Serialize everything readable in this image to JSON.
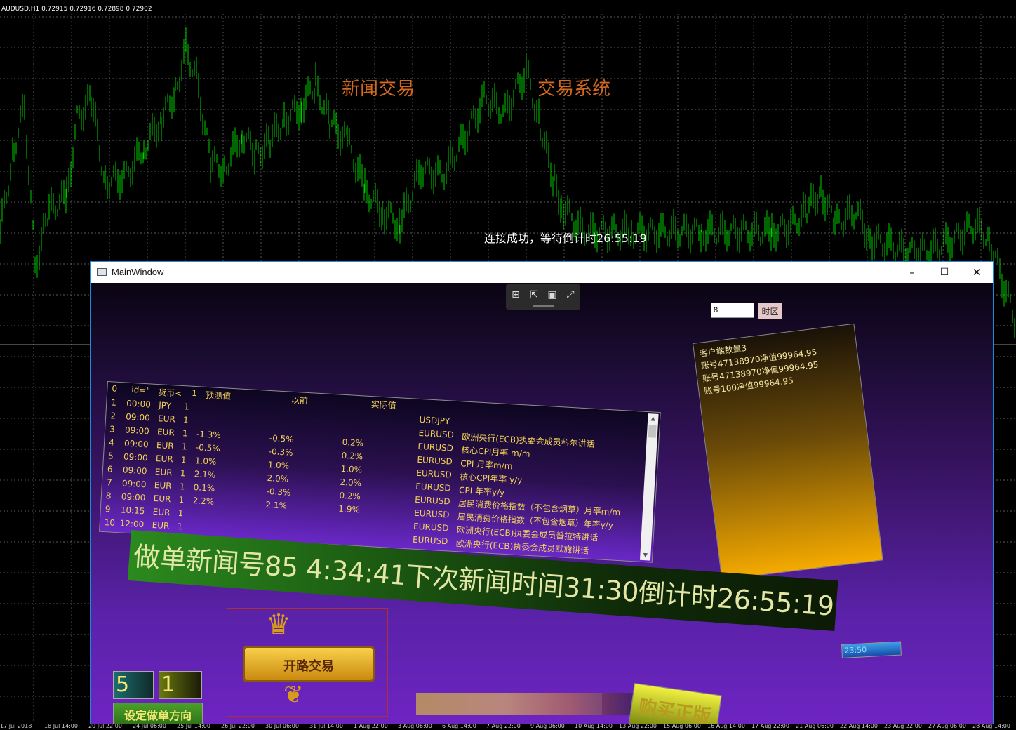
{
  "chart": {
    "title": "AUDUSD,H1  0.72915 0.72916 0.72898 0.72902",
    "caption_left": "新闻交易",
    "caption_right": "交易系统",
    "status": "连接成功，等待倒计时26:55:19",
    "x_labels": [
      "17 Jul 2018",
      "18 Jul 14:00",
      "20 Jul 22:00",
      "24 Jul 06:00",
      "25 Jul 14:00",
      "26 Jul 22:00",
      "30 Jul 06:00",
      "31 Jul 14:00",
      "1 Aug 22:00",
      "3 Aug 06:00",
      "6 Aug 14:00",
      "7 Aug 22:00",
      "9 Aug 06:00",
      "10 Aug 14:00",
      "13 Aug 22:00",
      "15 Aug 06:00",
      "16 Aug 14:00",
      "17 Aug 22:00",
      "21 Aug 06:00",
      "22 Aug 14:00",
      "23 Aug 22:00",
      "27 Aug 06:00",
      "28 Aug 14:00"
    ],
    "colors": {
      "candles": "#00cc00",
      "grid": "#7a7a7a",
      "caption": "#d2691e"
    }
  },
  "window": {
    "title": "MainWindow",
    "controls": {
      "minimize": "–",
      "maximize": "☐",
      "close": "✕"
    },
    "toolbar_icons": [
      "live-tree-icon",
      "select-element-icon",
      "display-layout-icon",
      "track-focus-icon"
    ],
    "timezone": {
      "value": "8",
      "button": "时区"
    },
    "table": {
      "header": [
        "0",
        "id=\"",
        "货币<",
        "1",
        "预测值",
        "以前",
        "实际值"
      ],
      "rows": [
        {
          "n": "1",
          "time": "00:00",
          "cur": "JPY",
          "imp": "1",
          "forecast": "",
          "previous": "",
          "actual": "",
          "symbol": "USDJPY",
          "event": ""
        },
        {
          "n": "2",
          "time": "09:00",
          "cur": "EUR",
          "imp": "1",
          "forecast": "",
          "previous": "",
          "actual": "",
          "symbol": "EURUSD",
          "event": "欧洲央行(ECB)执委会成员科尔讲话"
        },
        {
          "n": "3",
          "time": "09:00",
          "cur": "EUR",
          "imp": "1",
          "forecast": "-1.3%",
          "previous": "-0.5%",
          "actual": "0.2%",
          "symbol": "EURUSD",
          "event": "核心CPI月率 m/m"
        },
        {
          "n": "4",
          "time": "09:00",
          "cur": "EUR",
          "imp": "1",
          "forecast": "-0.5%",
          "previous": "-0.3%",
          "actual": "0.2%",
          "symbol": "EURUSD",
          "event": "CPI 月率m/m"
        },
        {
          "n": "5",
          "time": "09:00",
          "cur": "EUR",
          "imp": "1",
          "forecast": "1.0%",
          "previous": "1.0%",
          "actual": "1.0%",
          "symbol": "EURUSD",
          "event": "核心CPI年率 y/y"
        },
        {
          "n": "6",
          "time": "09:00",
          "cur": "EUR",
          "imp": "1",
          "forecast": "2.1%",
          "previous": "2.0%",
          "actual": "2.0%",
          "symbol": "EURUSD",
          "event": "CPI 年率y/y"
        },
        {
          "n": "7",
          "time": "09:00",
          "cur": "EUR",
          "imp": "1",
          "forecast": "0.1%",
          "previous": "-0.3%",
          "actual": "0.2%",
          "symbol": "EURUSD",
          "event": "居民消费价格指数（不包含烟草）月率m/m"
        },
        {
          "n": "8",
          "time": "09:00",
          "cur": "EUR",
          "imp": "1",
          "forecast": "2.2%",
          "previous": "2.1%",
          "actual": "1.9%",
          "symbol": "EURUSD",
          "event": "居民消费价格指数（不包含烟草）年率y/y"
        },
        {
          "n": "9",
          "time": "10:15",
          "cur": "EUR",
          "imp": "1",
          "forecast": "",
          "previous": "",
          "actual": "",
          "symbol": "EURUSD",
          "event": "欧洲央行(ECB)执委会成员普拉特讲话"
        },
        {
          "n": "10",
          "time": "12:00",
          "cur": "EUR",
          "imp": "1",
          "forecast": "",
          "previous": "",
          "actual": "",
          "symbol": "EURUSD",
          "event": "欧洲央行(ECB)执委会成员默施讲话"
        }
      ]
    },
    "accounts": {
      "title": "客户端数量3",
      "lines": [
        "账号47138970净值99964.95",
        "账号47138970净值99964.95",
        "账号100净值99964.95"
      ]
    },
    "banner": "做单新闻号85  4:34:41下次新闻时间31:30倒计时26:55:19",
    "num_box_1": "5",
    "num_box_2": "1",
    "direction_button": "设定做单方向",
    "logo_text": "开路交易",
    "small_time": "23:50",
    "buy_button": "购买正版",
    "progress": 0.85
  }
}
